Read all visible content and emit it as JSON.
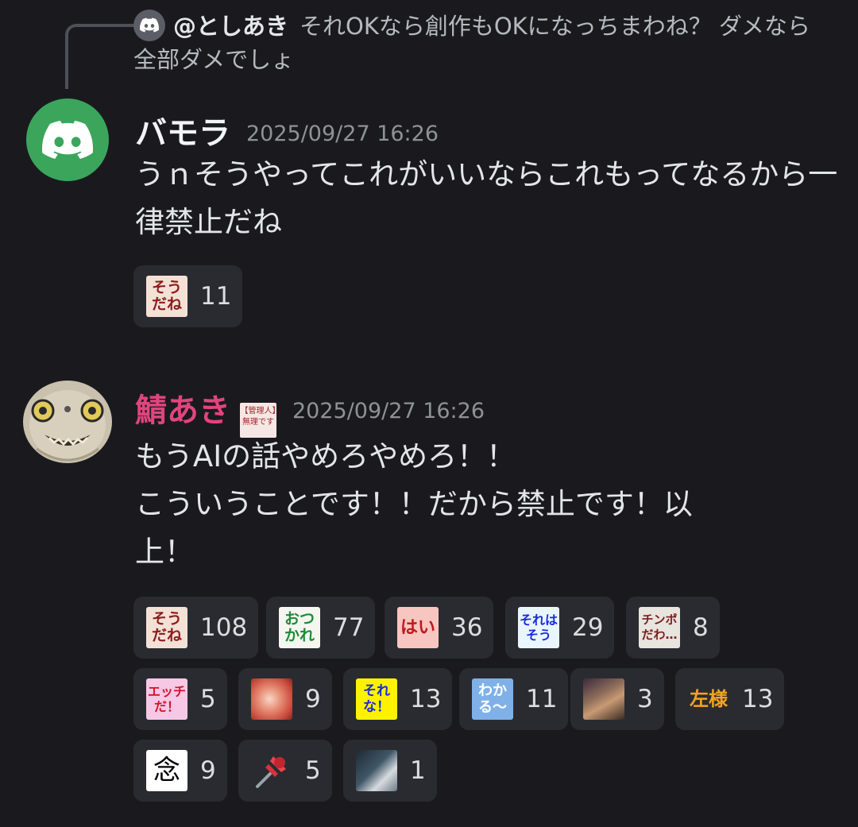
{
  "reply": {
    "username": "@としあき",
    "text": "それOKなら創作もOKになっちまわね？ ダメなら全部ダメでしょ"
  },
  "messages": [
    {
      "author": "バモラ",
      "timestamp": "2025/09/27 16:26",
      "text": "うｎそうやってこれがいいならこれもってなるから一律禁止だね",
      "reactions": [
        {
          "emoji": "soudane",
          "label": "そう だね",
          "count": "11"
        }
      ]
    },
    {
      "author": "鯖あき",
      "role_badge": "【管理人】無理です",
      "timestamp": "2025/09/27 16:26",
      "lines": [
        "もうAIの話やめろやめろ！！",
        "こういうことです！！だから禁止です！以",
        "上！"
      ],
      "reactions": [
        {
          "emoji": "soudane",
          "label": "そう だね",
          "count": "108"
        },
        {
          "emoji": "otsukare",
          "label": "おつ かれ",
          "count": "77"
        },
        {
          "emoji": "hai",
          "label": "はい",
          "count": "36"
        },
        {
          "emoji": "rewa-sou",
          "label": "それは そう",
          "count": "29"
        },
        {
          "emoji": "chinpo-dawa",
          "label": "チンポ だわ…",
          "count": "8"
        },
        {
          "emoji": "ecchi-da",
          "label": "エッチ だ！",
          "count": "5"
        },
        {
          "emoji": "burst-image",
          "label": "",
          "count": "9"
        },
        {
          "emoji": "sore-na",
          "label": "それ な！",
          "count": "13"
        },
        {
          "emoji": "wakaru",
          "label": "わか る〜",
          "count": "11"
        },
        {
          "emoji": "anime-face",
          "label": "",
          "count": "3"
        },
        {
          "emoji": "hidarisama",
          "label": "左様",
          "count": "13"
        },
        {
          "emoji": "nen",
          "label": "念",
          "count": "9"
        },
        {
          "emoji": "pushpin",
          "label": "",
          "count": "5"
        },
        {
          "emoji": "thumbs-photo",
          "label": "",
          "count": "1"
        }
      ]
    }
  ],
  "colors": {
    "background": "#1a1a1e",
    "reaction_bg": "#2a2b30",
    "username_pink": "#e0457b",
    "avatar_green": "#3ba55c"
  }
}
